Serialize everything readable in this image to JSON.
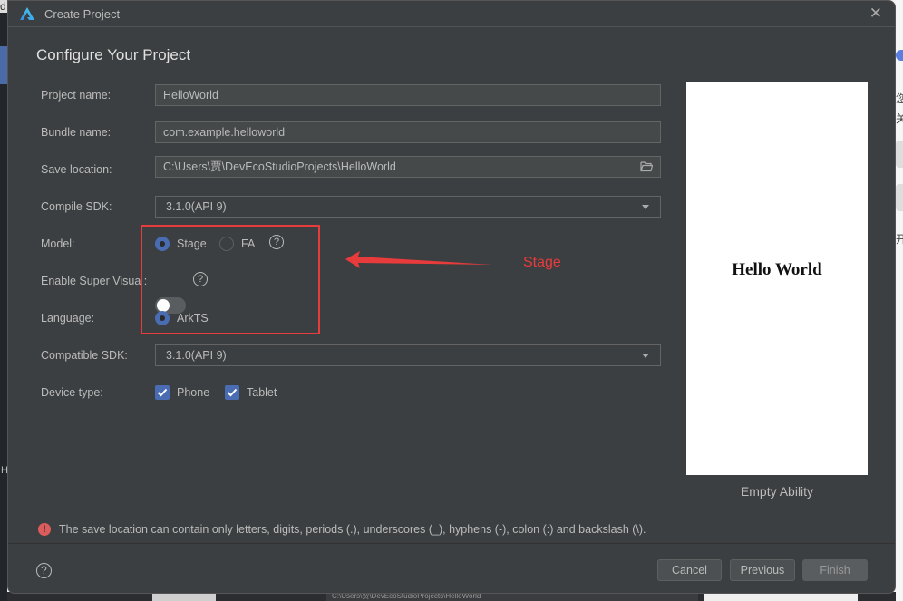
{
  "dialog": {
    "title": "Create Project",
    "close_icon": "close-icon",
    "heading": "Configure Your Project"
  },
  "form": {
    "project_name": {
      "label": "Project name:",
      "value": "HelloWorld"
    },
    "bundle_name": {
      "label": "Bundle name:",
      "value": "com.example.helloworld"
    },
    "save_location": {
      "label": "Save location:",
      "value": "C:\\Users\\贾\\DevEcoStudioProjects\\HelloWorld",
      "icon": "folder-icon"
    },
    "compile_sdk": {
      "label": "Compile SDK:",
      "value": "3.1.0(API 9)"
    },
    "model": {
      "label": "Model:",
      "options": [
        {
          "label": "Stage",
          "selected": true
        },
        {
          "label": "FA",
          "selected": false
        }
      ],
      "help": "?"
    },
    "super_visual": {
      "label": "Enable Super Visua :",
      "enabled": false,
      "help": "?"
    },
    "language": {
      "label": "Language:",
      "options": [
        {
          "label": "ArkTS",
          "selected": true
        }
      ]
    },
    "compatible_sdk": {
      "label": "Compatible SDK:",
      "value": "3.1.0(API 9)"
    },
    "device_type": {
      "label": "Device type:",
      "options": [
        {
          "label": "Phone",
          "checked": true
        },
        {
          "label": "Tablet",
          "checked": true
        }
      ]
    }
  },
  "annotation": {
    "text": "Stage",
    "color": "#e83b3b"
  },
  "preview": {
    "text": "Hello World",
    "caption": "Empty Ability"
  },
  "error": {
    "icon": "!",
    "message": "The save location can contain only letters, digits, periods (.), underscores (_), hyphens (-), colon (:) and backslash (\\)."
  },
  "footer": {
    "help": "?",
    "cancel": "Cancel",
    "previous": "Previous",
    "finish": "Finish"
  },
  "colors": {
    "accent": "#4a6cb3",
    "background": "#3c3f41",
    "error": "#db5c5c"
  },
  "background_app": {
    "bottom_path": "C:\\Users\\贾\\DevEcoStudioProjects\\HelloWorld"
  }
}
